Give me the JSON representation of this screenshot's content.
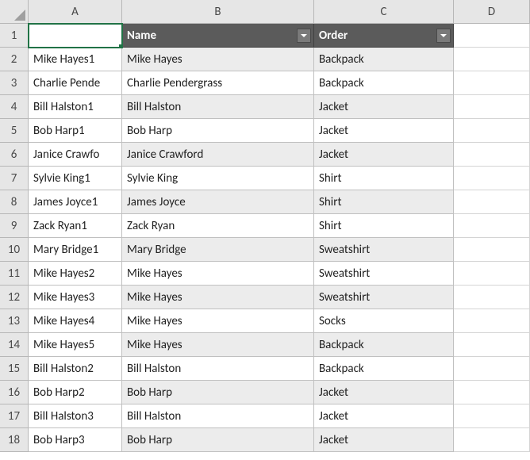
{
  "columns": [
    "A",
    "B",
    "C",
    "D"
  ],
  "table_header": {
    "a": "",
    "name_label": "Name",
    "order_label": "Order"
  },
  "rows": [
    {
      "n": 2,
      "a": "Mike Hayes1",
      "name": "Mike Hayes",
      "order": "Backpack"
    },
    {
      "n": 3,
      "a": "Charlie Pende",
      "name": "Charlie Pendergrass",
      "order": "Backpack"
    },
    {
      "n": 4,
      "a": "Bill Halston1",
      "name": "Bill Halston",
      "order": "Jacket"
    },
    {
      "n": 5,
      "a": "Bob Harp1",
      "name": "Bob Harp",
      "order": "Jacket"
    },
    {
      "n": 6,
      "a": "Janice Crawfo",
      "name": "Janice Crawford",
      "order": "Jacket"
    },
    {
      "n": 7,
      "a": "Sylvie King1",
      "name": "Sylvie King",
      "order": "Shirt"
    },
    {
      "n": 8,
      "a": "James Joyce1",
      "name": "James Joyce",
      "order": "Shirt"
    },
    {
      "n": 9,
      "a": "Zack Ryan1",
      "name": "Zack Ryan",
      "order": "Shirt"
    },
    {
      "n": 10,
      "a": "Mary Bridge1",
      "name": "Mary Bridge",
      "order": "Sweatshirt"
    },
    {
      "n": 11,
      "a": "Mike Hayes2",
      "name": "Mike Hayes",
      "order": "Sweatshirt"
    },
    {
      "n": 12,
      "a": "Mike Hayes3",
      "name": "Mike Hayes",
      "order": "Sweatshirt"
    },
    {
      "n": 13,
      "a": "Mike Hayes4",
      "name": "Mike Hayes",
      "order": "Socks"
    },
    {
      "n": 14,
      "a": "Mike Hayes5",
      "name": "Mike Hayes",
      "order": "Backpack"
    },
    {
      "n": 15,
      "a": "Bill Halston2",
      "name": "Bill Halston",
      "order": "Backpack"
    },
    {
      "n": 16,
      "a": "Bob Harp2",
      "name": "Bob Harp",
      "order": "Jacket"
    },
    {
      "n": 17,
      "a": "Bill Halston3",
      "name": "Bill Halston",
      "order": "Jacket"
    },
    {
      "n": 18,
      "a": "Bob Harp3",
      "name": "Bob Harp",
      "order": "Jacket"
    }
  ]
}
